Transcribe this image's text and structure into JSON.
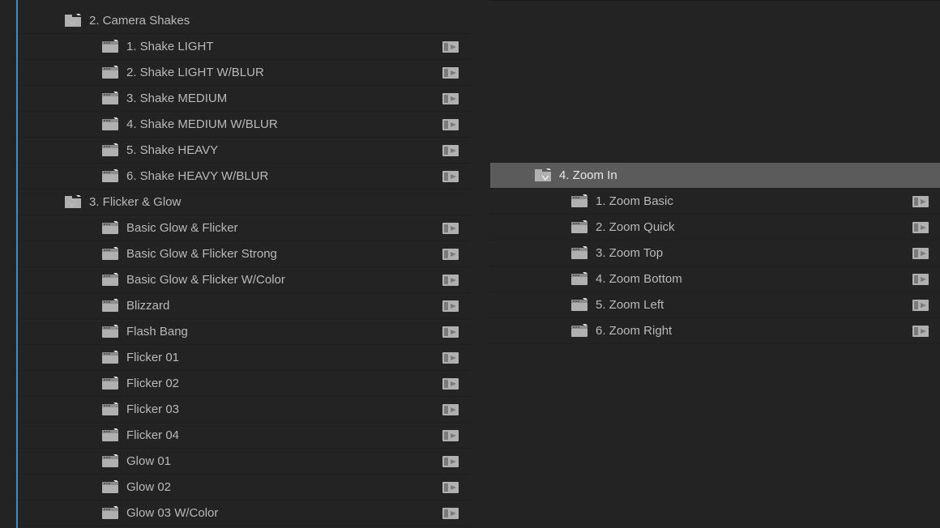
{
  "leftPanel": {
    "folders": [
      {
        "label": "2. Camera Shakes",
        "expanded": true,
        "items": [
          "1. Shake LIGHT",
          "2. Shake LIGHT W/BLUR",
          "3. Shake MEDIUM",
          "4. Shake MEDIUM W/BLUR",
          "5. Shake HEAVY",
          "6. Shake HEAVY W/BLUR"
        ]
      },
      {
        "label": "3. Flicker & Glow",
        "expanded": true,
        "items": [
          "Basic Glow & Flicker",
          "Basic Glow & Flicker Strong",
          "Basic Glow & Flicker W/Color",
          "Blizzard",
          "Flash Bang",
          "Flicker 01",
          "Flicker 02",
          "Flicker 03",
          "Flicker 04",
          "Glow 01",
          "Glow 02",
          "Glow 03 W/Color"
        ]
      }
    ]
  },
  "rightPanel": {
    "folder": {
      "label": "4. Zoom In",
      "expanded": true,
      "selected": true,
      "items": [
        "1. Zoom Basic",
        "2. Zoom Quick",
        "3. Zoom Top",
        "4. Zoom Bottom",
        "5. Zoom Left",
        "6. Zoom Right"
      ]
    }
  },
  "colors": {
    "background": "#232323",
    "selectedRow": "#5b5b5b",
    "text": "#b9b9b9",
    "textSelected": "#e8e8e8",
    "accentFocus": "#3a8ac9",
    "rowBorder": "#1e1e1e"
  }
}
